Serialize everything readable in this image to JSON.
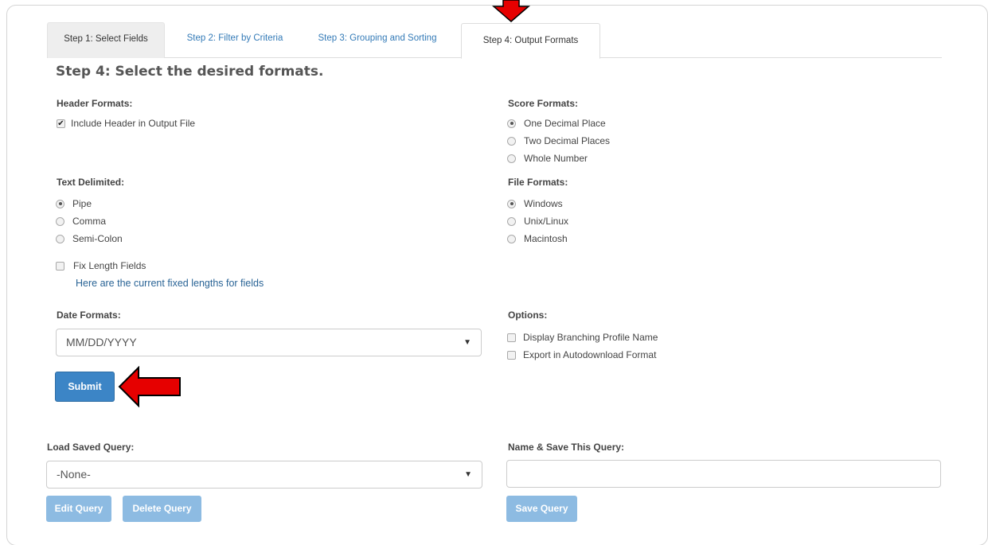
{
  "tabs": [
    {
      "label": "Step 1: Select Fields"
    },
    {
      "label": "Step 2: Filter by Criteria"
    },
    {
      "label": "Step 3: Grouping and Sorting"
    },
    {
      "label": "Step 4: Output Formats"
    }
  ],
  "step_title": "Step 4: Select the desired formats.",
  "header_formats": {
    "label": "Header Formats:",
    "include_header": {
      "label": "Include Header in Output File",
      "checked": true
    }
  },
  "score_formats": {
    "label": "Score Formats:",
    "options": [
      {
        "label": "One Decimal Place",
        "selected": true
      },
      {
        "label": "Two Decimal Places",
        "selected": false
      },
      {
        "label": "Whole Number",
        "selected": false
      }
    ]
  },
  "text_delimited": {
    "label": "Text Delimited:",
    "options": [
      {
        "label": "Pipe",
        "selected": true
      },
      {
        "label": "Comma",
        "selected": false
      },
      {
        "label": "Semi-Colon",
        "selected": false
      }
    ],
    "fix_length": {
      "label": "Fix Length Fields",
      "checked": false
    },
    "fixed_lengths_link": "Here are the current fixed lengths for fields"
  },
  "file_formats": {
    "label": "File Formats:",
    "options": [
      {
        "label": "Windows",
        "selected": true
      },
      {
        "label": "Unix/Linux",
        "selected": false
      },
      {
        "label": "Macintosh",
        "selected": false
      }
    ]
  },
  "date_formats": {
    "label": "Date Formats:",
    "value": "MM/DD/YYYY"
  },
  "options": {
    "label": "Options:",
    "items": [
      {
        "label": "Display Branching Profile Name",
        "checked": false
      },
      {
        "label": "Export in Autodownload Format",
        "checked": false
      }
    ]
  },
  "submit_label": "Submit",
  "load_saved_query": {
    "label": "Load Saved Query:",
    "value": "-None-"
  },
  "name_save_query": {
    "label": "Name & Save This Query:",
    "value": ""
  },
  "buttons": {
    "edit": "Edit Query",
    "delete": "Delete Query",
    "save": "Save Query"
  },
  "colors": {
    "primary": "#3c85c6",
    "disabled": "#8dbbe2",
    "link": "#337ab7",
    "arrow": "#e60000"
  }
}
